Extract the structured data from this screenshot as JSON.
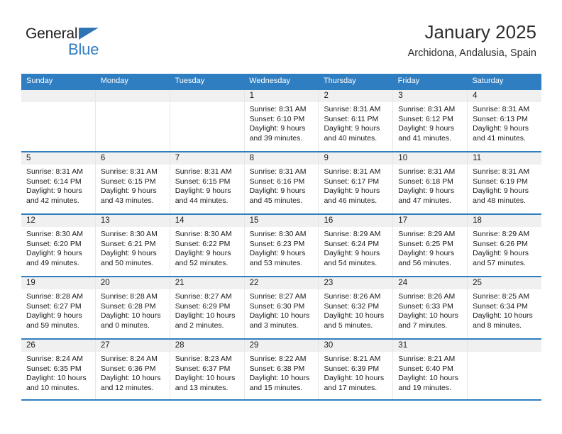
{
  "brand": {
    "name_top": "General",
    "name_bottom": "Blue",
    "triangle_icon": "triangle-icon",
    "accent_color": "#2f7ec1"
  },
  "header": {
    "title": "January 2025",
    "subtitle": "Archidona, Andalusia, Spain"
  },
  "weekdays": [
    "Sunday",
    "Monday",
    "Tuesday",
    "Wednesday",
    "Thursday",
    "Friday",
    "Saturday"
  ],
  "weeks": [
    [
      {
        "day": "",
        "empty": true
      },
      {
        "day": "",
        "empty": true
      },
      {
        "day": "",
        "empty": true
      },
      {
        "day": "1",
        "sunrise": "Sunrise: 8:31 AM",
        "sunset": "Sunset: 6:10 PM",
        "daylight1": "Daylight: 9 hours",
        "daylight2": "and 39 minutes."
      },
      {
        "day": "2",
        "sunrise": "Sunrise: 8:31 AM",
        "sunset": "Sunset: 6:11 PM",
        "daylight1": "Daylight: 9 hours",
        "daylight2": "and 40 minutes."
      },
      {
        "day": "3",
        "sunrise": "Sunrise: 8:31 AM",
        "sunset": "Sunset: 6:12 PM",
        "daylight1": "Daylight: 9 hours",
        "daylight2": "and 41 minutes."
      },
      {
        "day": "4",
        "sunrise": "Sunrise: 8:31 AM",
        "sunset": "Sunset: 6:13 PM",
        "daylight1": "Daylight: 9 hours",
        "daylight2": "and 41 minutes."
      }
    ],
    [
      {
        "day": "5",
        "sunrise": "Sunrise: 8:31 AM",
        "sunset": "Sunset: 6:14 PM",
        "daylight1": "Daylight: 9 hours",
        "daylight2": "and 42 minutes."
      },
      {
        "day": "6",
        "sunrise": "Sunrise: 8:31 AM",
        "sunset": "Sunset: 6:15 PM",
        "daylight1": "Daylight: 9 hours",
        "daylight2": "and 43 minutes."
      },
      {
        "day": "7",
        "sunrise": "Sunrise: 8:31 AM",
        "sunset": "Sunset: 6:15 PM",
        "daylight1": "Daylight: 9 hours",
        "daylight2": "and 44 minutes."
      },
      {
        "day": "8",
        "sunrise": "Sunrise: 8:31 AM",
        "sunset": "Sunset: 6:16 PM",
        "daylight1": "Daylight: 9 hours",
        "daylight2": "and 45 minutes."
      },
      {
        "day": "9",
        "sunrise": "Sunrise: 8:31 AM",
        "sunset": "Sunset: 6:17 PM",
        "daylight1": "Daylight: 9 hours",
        "daylight2": "and 46 minutes."
      },
      {
        "day": "10",
        "sunrise": "Sunrise: 8:31 AM",
        "sunset": "Sunset: 6:18 PM",
        "daylight1": "Daylight: 9 hours",
        "daylight2": "and 47 minutes."
      },
      {
        "day": "11",
        "sunrise": "Sunrise: 8:31 AM",
        "sunset": "Sunset: 6:19 PM",
        "daylight1": "Daylight: 9 hours",
        "daylight2": "and 48 minutes."
      }
    ],
    [
      {
        "day": "12",
        "sunrise": "Sunrise: 8:30 AM",
        "sunset": "Sunset: 6:20 PM",
        "daylight1": "Daylight: 9 hours",
        "daylight2": "and 49 minutes."
      },
      {
        "day": "13",
        "sunrise": "Sunrise: 8:30 AM",
        "sunset": "Sunset: 6:21 PM",
        "daylight1": "Daylight: 9 hours",
        "daylight2": "and 50 minutes."
      },
      {
        "day": "14",
        "sunrise": "Sunrise: 8:30 AM",
        "sunset": "Sunset: 6:22 PM",
        "daylight1": "Daylight: 9 hours",
        "daylight2": "and 52 minutes."
      },
      {
        "day": "15",
        "sunrise": "Sunrise: 8:30 AM",
        "sunset": "Sunset: 6:23 PM",
        "daylight1": "Daylight: 9 hours",
        "daylight2": "and 53 minutes."
      },
      {
        "day": "16",
        "sunrise": "Sunrise: 8:29 AM",
        "sunset": "Sunset: 6:24 PM",
        "daylight1": "Daylight: 9 hours",
        "daylight2": "and 54 minutes."
      },
      {
        "day": "17",
        "sunrise": "Sunrise: 8:29 AM",
        "sunset": "Sunset: 6:25 PM",
        "daylight1": "Daylight: 9 hours",
        "daylight2": "and 56 minutes."
      },
      {
        "day": "18",
        "sunrise": "Sunrise: 8:29 AM",
        "sunset": "Sunset: 6:26 PM",
        "daylight1": "Daylight: 9 hours",
        "daylight2": "and 57 minutes."
      }
    ],
    [
      {
        "day": "19",
        "sunrise": "Sunrise: 8:28 AM",
        "sunset": "Sunset: 6:27 PM",
        "daylight1": "Daylight: 9 hours",
        "daylight2": "and 59 minutes."
      },
      {
        "day": "20",
        "sunrise": "Sunrise: 8:28 AM",
        "sunset": "Sunset: 6:28 PM",
        "daylight1": "Daylight: 10 hours",
        "daylight2": "and 0 minutes."
      },
      {
        "day": "21",
        "sunrise": "Sunrise: 8:27 AM",
        "sunset": "Sunset: 6:29 PM",
        "daylight1": "Daylight: 10 hours",
        "daylight2": "and 2 minutes."
      },
      {
        "day": "22",
        "sunrise": "Sunrise: 8:27 AM",
        "sunset": "Sunset: 6:30 PM",
        "daylight1": "Daylight: 10 hours",
        "daylight2": "and 3 minutes."
      },
      {
        "day": "23",
        "sunrise": "Sunrise: 8:26 AM",
        "sunset": "Sunset: 6:32 PM",
        "daylight1": "Daylight: 10 hours",
        "daylight2": "and 5 minutes."
      },
      {
        "day": "24",
        "sunrise": "Sunrise: 8:26 AM",
        "sunset": "Sunset: 6:33 PM",
        "daylight1": "Daylight: 10 hours",
        "daylight2": "and 7 minutes."
      },
      {
        "day": "25",
        "sunrise": "Sunrise: 8:25 AM",
        "sunset": "Sunset: 6:34 PM",
        "daylight1": "Daylight: 10 hours",
        "daylight2": "and 8 minutes."
      }
    ],
    [
      {
        "day": "26",
        "sunrise": "Sunrise: 8:24 AM",
        "sunset": "Sunset: 6:35 PM",
        "daylight1": "Daylight: 10 hours",
        "daylight2": "and 10 minutes."
      },
      {
        "day": "27",
        "sunrise": "Sunrise: 8:24 AM",
        "sunset": "Sunset: 6:36 PM",
        "daylight1": "Daylight: 10 hours",
        "daylight2": "and 12 minutes."
      },
      {
        "day": "28",
        "sunrise": "Sunrise: 8:23 AM",
        "sunset": "Sunset: 6:37 PM",
        "daylight1": "Daylight: 10 hours",
        "daylight2": "and 13 minutes."
      },
      {
        "day": "29",
        "sunrise": "Sunrise: 8:22 AM",
        "sunset": "Sunset: 6:38 PM",
        "daylight1": "Daylight: 10 hours",
        "daylight2": "and 15 minutes."
      },
      {
        "day": "30",
        "sunrise": "Sunrise: 8:21 AM",
        "sunset": "Sunset: 6:39 PM",
        "daylight1": "Daylight: 10 hours",
        "daylight2": "and 17 minutes."
      },
      {
        "day": "31",
        "sunrise": "Sunrise: 8:21 AM",
        "sunset": "Sunset: 6:40 PM",
        "daylight1": "Daylight: 10 hours",
        "daylight2": "and 19 minutes."
      },
      {
        "day": "",
        "empty": true
      }
    ]
  ]
}
